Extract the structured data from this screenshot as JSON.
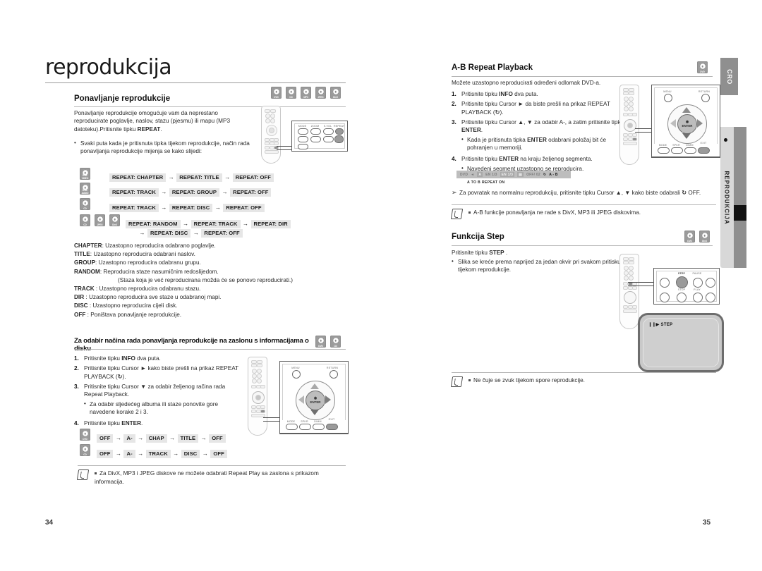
{
  "document": {
    "chapter_title": "reprodukcija",
    "left_page_number": "34",
    "right_page_number": "35",
    "side_tab_language": "CRO",
    "side_tab_section": "REPRODUKCIJA"
  },
  "left_page": {
    "section1": {
      "heading": "Ponavljanje reprodukcije",
      "disc_icons": [
        "DVD",
        "CD",
        "MP3",
        "JPEG",
        "DivX"
      ],
      "intro": "Ponavljanje reprodukcije omogućuje vam da neprestano reproducirate poglavlje, naslov, stazu (pjesmu) ili mapu (MP3 datoteku).Pritisnite tipku REPEAT.",
      "intro_bold": "REPEAT",
      "bullet": "Svaki puta kada je pritisnuta tipka tijekom reprodukcije, način rada ponavljanja reprodukcije mijenja se kako slijedi:",
      "sequences": [
        {
          "discs": [
            "DVD-VIDEO"
          ],
          "items": [
            "REPEAT: CHAPTER",
            "REPEAT: TITLE",
            "REPEAT: OFF"
          ],
          "items2": []
        },
        {
          "discs": [
            "DVD-AUDIO"
          ],
          "items": [
            "REPEAT: TRACK",
            "REPEAT: GROUP",
            "REPEAT: OFF"
          ],
          "items2": []
        },
        {
          "discs": [
            "CD"
          ],
          "items": [
            "REPEAT: TRACK",
            "REPEAT: DISC",
            "REPEAT: OFF"
          ],
          "items2": []
        },
        {
          "discs": [
            "CD",
            "JPEG",
            "DivX"
          ],
          "items": [
            "REPEAT: RANDOM",
            "REPEAT: TRACK",
            "REPEAT: DIR"
          ],
          "items2": [
            "REPEAT: DISC",
            "REPEAT: OFF"
          ]
        }
      ],
      "definitions": [
        {
          "term": "CHAPTER",
          "sep": ":",
          "text": "Uzastopno reproducira odabrano poglavlje."
        },
        {
          "term": "TITLE",
          "sep": ":",
          "text": "Uzastopno reproducira odabrani naslov."
        },
        {
          "term": "GROUP",
          "sep": ":",
          "text": "Uzastopno reproducira odabranu grupu."
        },
        {
          "term": "RANDOM",
          "sep": ":",
          "text": "Reproducira staze nasumičnim redoslijedom."
        },
        {
          "term": "",
          "sep": "",
          "text": "(Staza koja je već reproducirana možda će se ponovo reproducirati.)",
          "indent": true
        },
        {
          "term": "TRACK",
          "sep": " :",
          "text": "Uzastopno reproducira odabranu stazu."
        },
        {
          "term": "DIR",
          "sep": " :",
          "text": "Uzastopno reproducira sve staze u odabranoj mapi."
        },
        {
          "term": "DISC",
          "sep": " :",
          "text": "Uzastopno reproducira cijeli disk."
        },
        {
          "term": "OFF",
          "sep": " :",
          "text": "Poništava ponavljanje reprodukcije."
        }
      ]
    },
    "section2": {
      "heading": "Za odabir načina rada ponavljanja reprodukcije na zaslonu s informacijama o disku",
      "disc_icons": [
        "DVD",
        "CD"
      ],
      "steps": [
        {
          "num": "1.",
          "pre": "Pritisnite tipku ",
          "bold": "INFO",
          "post": " dva puta."
        },
        {
          "num": "2.",
          "pre": "Pritisnite tipku Cursor ► kako biste prešli na prikaz REPEAT PLAYBACK (",
          "bold": "",
          "post": ")."
        },
        {
          "num": "3.",
          "pre": "Pritisnite tipku Cursor ▼ za odabir željenog račina rada Repeat Playback.",
          "bold": "",
          "post": ""
        },
        {
          "num": "4.",
          "pre": "Pritisnite tipku ",
          "bold": "ENTER",
          "post": "."
        }
      ],
      "substep": "Za odabir sljedećeg albuma ili staze ponovite gore navedene korake 2 i 3.",
      "sequences": [
        {
          "discs": [
            "DVD"
          ],
          "items": [
            "OFF",
            "A-",
            "CHAP",
            "TITLE",
            "OFF"
          ]
        },
        {
          "discs": [
            "CD"
          ],
          "items": [
            "OFF",
            "A-",
            "TRACK",
            "DISC",
            "OFF"
          ]
        }
      ],
      "note": "Za DivX, MP3 i JPEG diskove ne možete odabrati Repeat Play sa zaslona s prikazom informacija."
    }
  },
  "right_page": {
    "section_ab": {
      "heading": "A-B Repeat Playback",
      "disc_icons": [
        "DVD"
      ],
      "intro": "Možete uzastopno reproducirati određeni odlomak DVD-a.",
      "steps": [
        {
          "num": "1.",
          "pre": "Pritisnite tipku ",
          "bold": "INFO",
          "post": " dva puta."
        },
        {
          "num": "2.",
          "pre": "Pritisnite tipku Cursor ► da biste prešli na prikaz REPEAT PLAYBACK (",
          "bold": "",
          "post": ")."
        },
        {
          "num": "3.",
          "pre": "Pritisnite tipku Cursor ▲, ▼ za odabir A-, a zatim pritisnite tipku ",
          "bold": "ENTER",
          "post": "."
        },
        {
          "num": "4.",
          "pre": "Pritisnite tipku ",
          "bold": "ENTER",
          "post": " na kraju željenog segmenta."
        }
      ],
      "sub3": {
        "pre": "Kada je pritisnuta tipka ",
        "bold": "ENTER",
        "post": " odabrani položaj bit će pohranjen u memoriji."
      },
      "sub4": "Navedeni segment uzastopno se reproducira.",
      "osd": {
        "items": [
          "DVD",
          "◄",
          "EN 1/3",
          "EN 1/3",
          "OFF/ 02"
        ],
        "ab_label": "A - B",
        "caption": "A TO B REPEAT ON"
      },
      "tip": "Za povratak na normalnu reprodukciju, pritisnite tipku Cursor ▲, ▼ kako biste odabrali      OFF.",
      "note": "A-B funkcije ponavljanja ne rade s DivX, MP3 ili JPEG diskovima."
    },
    "section_step": {
      "heading": "Funkcija Step",
      "disc_icons": [
        "DVD",
        "DivX"
      ],
      "intro_pre": "Pritisnite tipku ",
      "intro_bold": "STEP",
      "intro_post": " .",
      "bullet": "Slika se kreće prema naprijed za jedan okvir pri svakom pritisku tipke tijekom reprodukcije.",
      "tv_osd": "STEP",
      "note": "Ne čuje se zvuk tijekom spore reprodukcije."
    }
  },
  "colors": {
    "chip_bg": "#e6e6e6",
    "disc_icon": "#9a9a9a",
    "tab_gray": "#8f8f8f",
    "rule": "#b5b5b5"
  }
}
